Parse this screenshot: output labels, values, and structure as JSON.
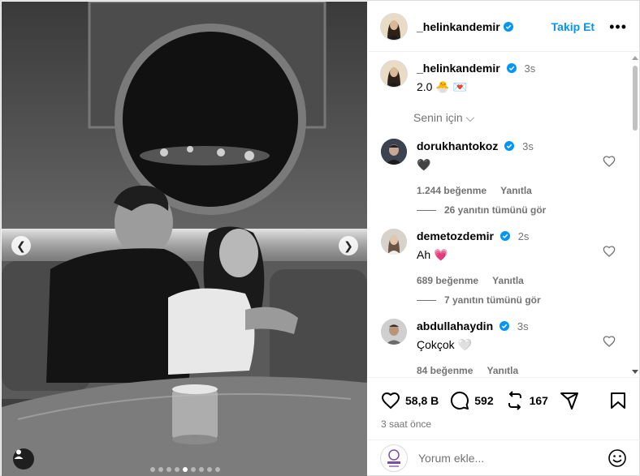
{
  "post": {
    "author": "_helinkandemir",
    "follow_label": "Takip Et",
    "more_label": "•••",
    "caption_author": "_helinkandemir",
    "caption_time": "3s",
    "caption_text": "2.0 🐣 💌",
    "filter_label": "Senin için ⌵",
    "likes": "58,8 B",
    "comments_count": "592",
    "reposts": "167",
    "posted": "3 saat önce",
    "comment_placeholder": "Yorum ekle...",
    "carousel": {
      "total": 9,
      "active": 5
    }
  },
  "comments": [
    {
      "user": "dorukhantokoz",
      "time": "3s",
      "text": "🖤",
      "likes": "1.244 beğenme",
      "reply": "Yanıtla",
      "view_replies": "26 yanıtın tümünü gör"
    },
    {
      "user": "demetozdemir",
      "time": "2s",
      "text": "Ah 💗",
      "likes": "689 beğenme",
      "reply": "Yanıtla",
      "view_replies": "7 yanıtın tümünü gör"
    },
    {
      "user": "abdullahaydin",
      "time": "3s",
      "text": "Çokçok 🤍",
      "likes": "84 beğenme",
      "reply": "Yanıtla"
    }
  ],
  "colors": {
    "accent": "#0095f6",
    "verified": "#0095f6",
    "muted": "#737373"
  },
  "icons": [
    "chevron-left-icon",
    "chevron-right-icon",
    "user-tag-icon",
    "verified-icon",
    "heart-icon",
    "comment-icon",
    "repost-icon",
    "share-icon",
    "bookmark-icon",
    "emoji-icon",
    "more-icon"
  ]
}
